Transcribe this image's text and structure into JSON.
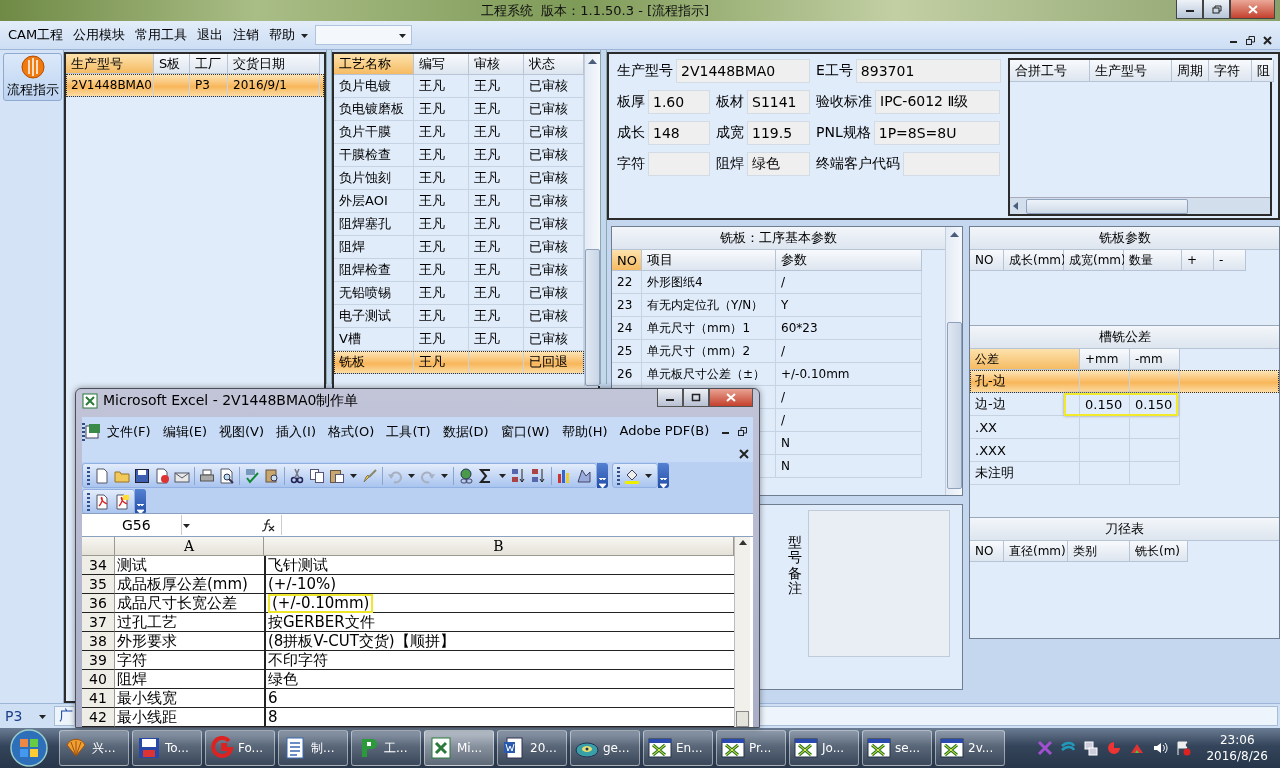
{
  "window": {
    "title": "工程系统  版本：1.1.50.3 - [流程指示]"
  },
  "menu": [
    "CAM工程",
    "公用模块",
    "常用工具",
    "退出",
    "注销",
    "帮助"
  ],
  "nav": [
    {
      "label": "流程指示",
      "selected": true
    }
  ],
  "orders": {
    "columns": [
      {
        "label": "生产型号",
        "active": true
      },
      {
        "label": "S板",
        "active": false
      },
      {
        "label": "工厂",
        "active": false
      },
      {
        "label": "交货日期",
        "active": false
      }
    ],
    "rows": [
      {
        "model": "2V1448BMA0",
        "factory": "P3",
        "date": "2016/9/1",
        "selected": true
      }
    ]
  },
  "process": {
    "columns": [
      {
        "label": "工艺名称",
        "active": true
      },
      {
        "label": "编写",
        "active": false
      },
      {
        "label": "审核",
        "active": false
      },
      {
        "label": "状态",
        "active": false
      }
    ],
    "rows": [
      {
        "name": "负片电镀",
        "writer": "王凡",
        "reviewer": "王凡",
        "status": "已审核",
        "selected": false
      },
      {
        "name": "负电镀磨板",
        "writer": "王凡",
        "reviewer": "王凡",
        "status": "已审核",
        "selected": false
      },
      {
        "name": "负片干膜",
        "writer": "王凡",
        "reviewer": "王凡",
        "status": "已审核",
        "selected": false
      },
      {
        "name": "干膜检查",
        "writer": "王凡",
        "reviewer": "王凡",
        "status": "已审核",
        "selected": false
      },
      {
        "name": "负片蚀刻",
        "writer": "王凡",
        "reviewer": "王凡",
        "status": "已审核",
        "selected": false
      },
      {
        "name": "外层AOI",
        "writer": "王凡",
        "reviewer": "王凡",
        "status": "已审核",
        "selected": false
      },
      {
        "name": "阻焊塞孔",
        "writer": "王凡",
        "reviewer": "王凡",
        "status": "已审核",
        "selected": false
      },
      {
        "name": "阻焊",
        "writer": "王凡",
        "reviewer": "王凡",
        "status": "已审核",
        "selected": false
      },
      {
        "name": "阻焊检查",
        "writer": "王凡",
        "reviewer": "王凡",
        "status": "已审核",
        "selected": false
      },
      {
        "name": "无铅喷锡",
        "writer": "王凡",
        "reviewer": "王凡",
        "status": "已审核",
        "selected": false
      },
      {
        "name": "电子测试",
        "writer": "王凡",
        "reviewer": "王凡",
        "status": "已审核",
        "selected": false
      },
      {
        "name": "V槽",
        "writer": "王凡",
        "reviewer": "王凡",
        "status": "已审核",
        "selected": false
      },
      {
        "name": "铣板",
        "writer": "王凡",
        "status": "已回退",
        "selected": true
      }
    ]
  },
  "info": {
    "fields": [
      {
        "label": "生产型号",
        "value": "2V1448BMA0"
      },
      {
        "label": "E工号",
        "value": "893701"
      },
      {
        "label": "板厚",
        "value": "1.60"
      },
      {
        "label": "板材",
        "value": "S1141"
      },
      {
        "label": "验收标准",
        "value": "IPC-6012 Ⅱ级"
      },
      {
        "label": "成长",
        "value": "148"
      },
      {
        "label": "成宽",
        "value": "119.5"
      },
      {
        "label": "PNL规格",
        "value": "1P=8S=8U"
      },
      {
        "label": "字符"
      },
      {
        "label": "阻焊",
        "value": "绿色"
      },
      {
        "label": "终端客户代码"
      }
    ]
  },
  "merge_table": {
    "columns": [
      "合拼工号",
      "生产型号",
      "周期",
      "字符",
      "阻"
    ]
  },
  "params": {
    "title": "铣板：工序基本参数",
    "columns": [
      {
        "label": "NO",
        "active": true
      },
      {
        "label": "项目",
        "active": false
      },
      {
        "label": "参数",
        "active": false
      }
    ],
    "rows": [
      {
        "no": "22",
        "item": "外形图纸4",
        "value": "/"
      },
      {
        "no": "23",
        "item": "有无内定位孔（Y/N）",
        "value": "Y"
      },
      {
        "no": "24",
        "item": "单元尺寸（mm）1",
        "value": "60*23"
      },
      {
        "no": "25",
        "item": "单元尺寸（mm）2",
        "value": "/"
      },
      {
        "no": "26",
        "item": "单元板尺寸公差（±）",
        "value": "+/-0.10mm"
      },
      {
        "value": "/"
      },
      {
        "value": "/"
      },
      {
        "value": "N"
      },
      {
        "value": "N"
      }
    ]
  },
  "remarks": {
    "label": "型号备注"
  },
  "mill_params": {
    "title": "铣板参数",
    "columns": [
      "NO",
      "成长(mm)",
      "成宽(mm)",
      "数量",
      "+",
      "-"
    ]
  },
  "tolerance": {
    "title": "槽铣公差",
    "columns": [
      {
        "label": "公差",
        "active": true
      },
      {
        "label": "+mm",
        "active": false
      },
      {
        "label": "-mm",
        "active": false
      }
    ],
    "rows": [
      {
        "name": "孔-边",
        "selected": true,
        "highlight": false
      },
      {
        "name": "边-边",
        "plus": "0.150",
        "minus": "0.150",
        "selected": false,
        "highlight": true
      },
      {
        "name": ".XX",
        "selected": false,
        "highlight": false
      },
      {
        "name": ".XXX",
        "selected": false,
        "highlight": false
      },
      {
        "name": "未注明",
        "selected": false,
        "highlight": false
      }
    ]
  },
  "cutters": {
    "title": "刀径表",
    "columns": [
      "NO",
      "直径(mm)",
      "类别",
      "铣长(m)"
    ]
  },
  "status_bar": {
    "combo": "P3",
    "field": "广"
  },
  "excel": {
    "title": "Microsoft Excel - 2V1448BMA0制作单",
    "menu": [
      "文件(F)",
      "编辑(E)",
      "视图(V)",
      "插入(I)",
      "格式(O)",
      "工具(T)",
      "数据(D)",
      "窗口(W)",
      "帮助(H)",
      "Adobe PDF(B)"
    ],
    "name_box": "G56",
    "columns": [
      "A",
      "B"
    ],
    "rows": [
      {
        "no": "34",
        "a": "测试",
        "b": "飞针测试",
        "highlight": false
      },
      {
        "no": "35",
        "a": "成品板厚公差(mm)",
        "b": "(+/-10%)",
        "highlight": false
      },
      {
        "no": "36",
        "a": "成品尺寸长宽公差",
        "b": "(+/-0.10mm)",
        "highlight": true
      },
      {
        "no": "37",
        "a": "过孔工艺",
        "b": "按GERBER文件",
        "highlight": false
      },
      {
        "no": "38",
        "a": "外形要求",
        "b": "(8拼板V-CUT交货)【顺拼】",
        "highlight": false
      },
      {
        "no": "39",
        "a": "字符",
        "b": "不印字符",
        "highlight": false
      },
      {
        "no": "40",
        "a": "阻焊",
        "b": "绿色",
        "highlight": false
      },
      {
        "no": "41",
        "a": "最小线宽",
        "b": "6",
        "highlight": false
      },
      {
        "no": "42",
        "a": "最小线距",
        "b": "8",
        "highlight": false
      }
    ]
  },
  "taskbar": {
    "items": [
      {
        "kind": "shell",
        "label": "兴...",
        "selected": false
      },
      {
        "kind": "disk",
        "label": "To...",
        "selected": false
      },
      {
        "kind": "swirl",
        "label": "Fo...",
        "selected": false
      },
      {
        "kind": "notepad",
        "label": "制...",
        "selected": false
      },
      {
        "kind": "app",
        "label": "工...",
        "selected": false
      },
      {
        "kind": "sheet",
        "label": "Mi...",
        "selected": true
      },
      {
        "kind": "doc",
        "label": "20...",
        "selected": false
      },
      {
        "kind": "disc",
        "label": "ge...",
        "selected": false
      },
      {
        "kind": "window",
        "label": "En...",
        "selected": false
      },
      {
        "kind": "window",
        "label": "Pr...",
        "selected": false
      },
      {
        "kind": "window",
        "label": "Jo...",
        "selected": false
      },
      {
        "kind": "window",
        "label": "se...",
        "selected": false
      },
      {
        "kind": "window",
        "label": "2v...",
        "selected": false
      }
    ],
    "time": "23:06",
    "date": "2016/8/26"
  }
}
